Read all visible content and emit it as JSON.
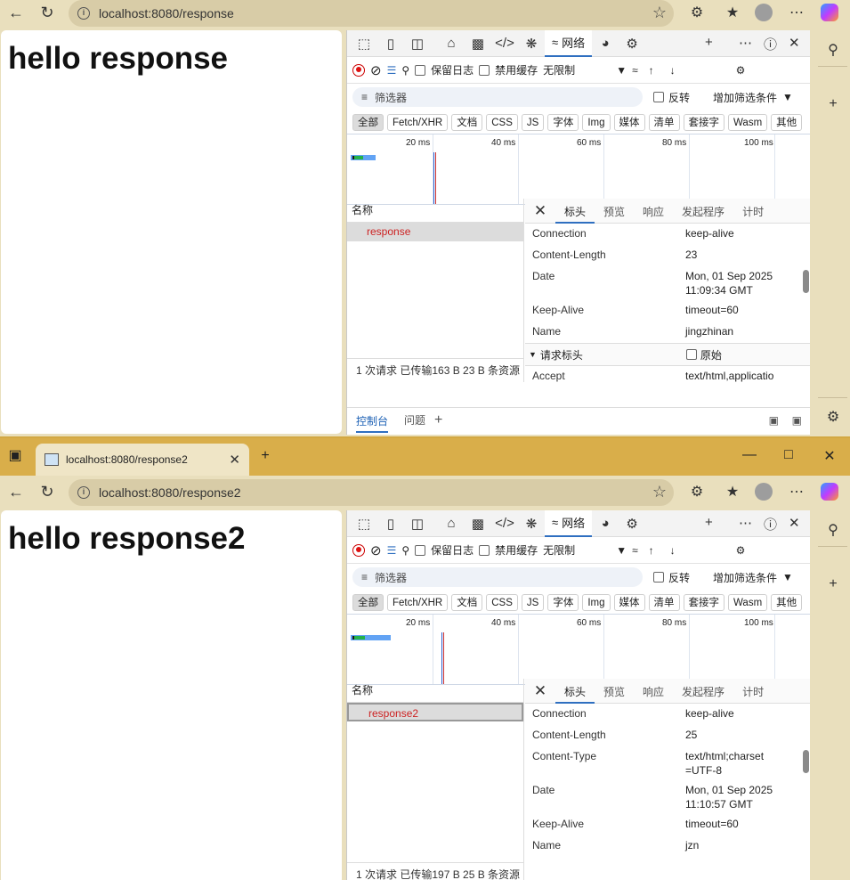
{
  "browser": {
    "url1": "localhost:8080/response",
    "url2": "localhost:8080/response2",
    "tab2_title": "localhost:8080/response2"
  },
  "page1": {
    "heading": "hello response"
  },
  "page2": {
    "heading": "hello response2"
  },
  "devtools": {
    "network_tab": "网络",
    "preserve_log": "保留日志",
    "disable_cache": "禁用缓存",
    "throttle": "无限制",
    "filter_placeholder": "筛选器",
    "invert": "反转",
    "more_filters": "增加筛选条件",
    "types": [
      "全部",
      "Fetch/XHR",
      "文档",
      "CSS",
      "JS",
      "字体",
      "Img",
      "媒体",
      "清单",
      "套接字",
      "Wasm",
      "其他"
    ],
    "timeline_labels": [
      "20 ms",
      "40 ms",
      "60 ms",
      "80 ms",
      "100 ms"
    ],
    "name_header": "名称",
    "detail_tabs": [
      "标头",
      "预览",
      "响应",
      "发起程序",
      "计时"
    ],
    "drawer_console": "控制台",
    "drawer_issues": "问题",
    "request_headers": "请求标头",
    "raw": "原始"
  },
  "panel1": {
    "request_name": "response",
    "status": "1 次请求  已传输163 B  23 B 条资源",
    "headers": [
      {
        "k": "Connection",
        "v": "keep-alive"
      },
      {
        "k": "Content-Length",
        "v": "23"
      },
      {
        "k": "Date",
        "v": "Mon, 01 Sep 2025 11:09:34 GMT"
      },
      {
        "k": "Keep-Alive",
        "v": "timeout=60"
      },
      {
        "k": "Name",
        "v": "jingzhinan"
      }
    ],
    "req_header": {
      "k": "Accept",
      "v": "text/html,applicatio"
    }
  },
  "panel2": {
    "request_name": "response2",
    "status": "1 次请求  已传输197 B  25 B 条资源",
    "headers": [
      {
        "k": "Connection",
        "v": "keep-alive"
      },
      {
        "k": "Content-Length",
        "v": "25"
      },
      {
        "k": "Content-Type",
        "v": "text/html;charset=UTF-8"
      },
      {
        "k": "Date",
        "v": "Mon, 01 Sep 2025 11:10:57 GMT"
      },
      {
        "k": "Keep-Alive",
        "v": "timeout=60"
      },
      {
        "k": "Name",
        "v": "jzn"
      }
    ]
  },
  "colors": {
    "accent": "#2f6fc0",
    "request_red": "#cc2222",
    "frame": "#d9ae4a"
  }
}
